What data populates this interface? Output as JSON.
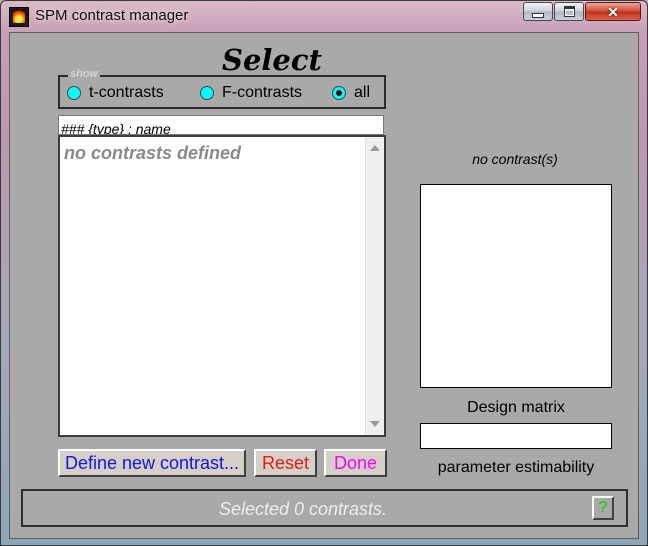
{
  "window": {
    "title": "SPM contrast manager",
    "close_glyph": "✕"
  },
  "panel": {
    "heading": "Select",
    "show_legend": "show",
    "filters": [
      {
        "label": "t-contrasts",
        "selected": false
      },
      {
        "label": "F-contrasts",
        "selected": false
      },
      {
        "label": "all",
        "selected": true
      }
    ],
    "list_header": "### {type} : name",
    "list_empty": "no contrasts defined"
  },
  "buttons": {
    "define": "Define new contrast...",
    "reset": "Reset",
    "done": "Done",
    "help": "?"
  },
  "design": {
    "no_contrast": "no contrast(s)",
    "design_matrix_label": "Design matrix",
    "estimability_label": "parameter estimability"
  },
  "status": {
    "text": "Selected 0 contrasts."
  },
  "colors": {
    "radio": "#00ffff",
    "define_text": "#1414e6",
    "reset_text": "#e01b1b",
    "done_text": "#ff00ff",
    "help_text": "#00d000",
    "panel_bg": "#a9a9a9"
  },
  "icons": {
    "app": "spm-flame-icon",
    "minimize": "minimize-icon",
    "maximize": "maximize-icon",
    "close": "close-icon"
  }
}
